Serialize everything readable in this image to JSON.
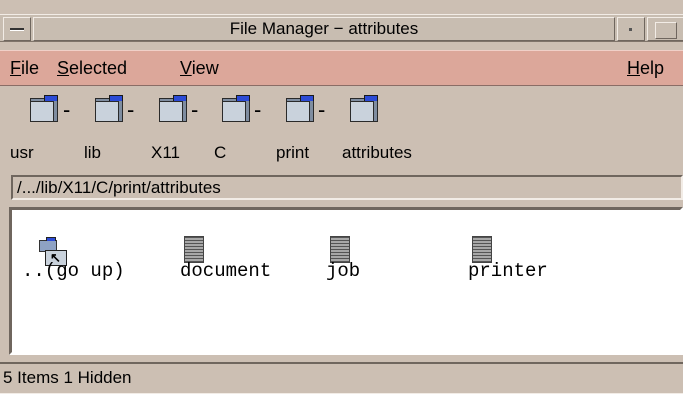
{
  "window": {
    "title": "File Manager − attributes"
  },
  "menubar": {
    "file": {
      "mnemonic": "F",
      "rest": "ile"
    },
    "selected": {
      "mnemonic": "S",
      "rest": "elected"
    },
    "view": {
      "mnemonic": "V",
      "rest": "iew"
    },
    "help": {
      "mnemonic": "H",
      "rest": "elp"
    }
  },
  "path_icons": [
    {
      "label": "usr"
    },
    {
      "label": "lib"
    },
    {
      "label": "X11"
    },
    {
      "label": "C"
    },
    {
      "label": "print"
    },
    {
      "label": "attributes"
    }
  ],
  "path_separator": "-",
  "path_field": {
    "value": "/.../lib/X11/C/print/attributes"
  },
  "files": [
    {
      "name": "..(go up)",
      "icon": "folder-up-icon"
    },
    {
      "name": "document",
      "icon": "document-icon"
    },
    {
      "name": "job",
      "icon": "document-icon"
    },
    {
      "name": "printer",
      "icon": "document-icon"
    }
  ],
  "status": {
    "text": "5 Items 1 Hidden"
  },
  "colors": {
    "menubar_bg": "#dca79a",
    "window_bg": "#ccbfb3",
    "folder_tab": "#2c4bd6"
  }
}
